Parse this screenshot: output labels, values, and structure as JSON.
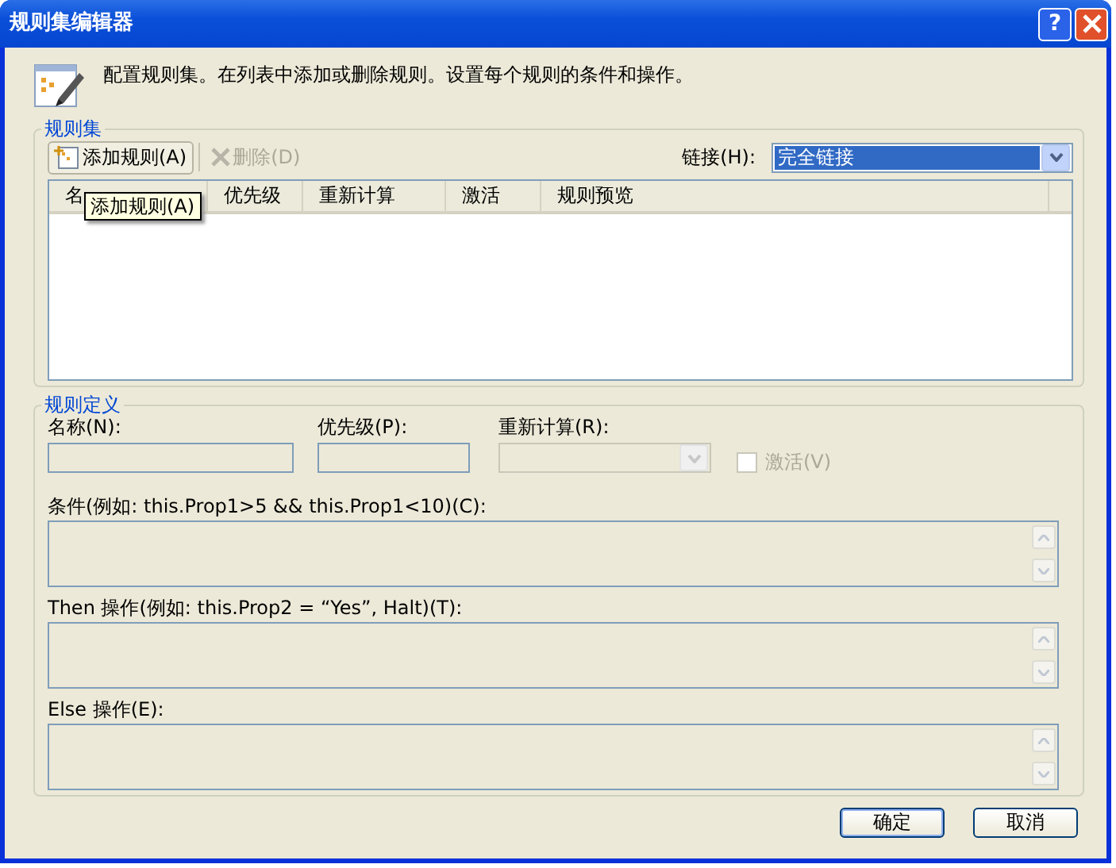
{
  "window": {
    "title": "规则集编辑器",
    "help": "?"
  },
  "description": "配置规则集。在列表中添加或删除规则。设置每个规则的条件和操作。",
  "rule_set": {
    "title": "规则集",
    "toolbar": [
      {
        "kind": "add",
        "label": "添加规则(A)",
        "disabled": false
      },
      {
        "kind": "delete",
        "label": "删除(D)",
        "disabled": true
      }
    ],
    "chaining": {
      "label": "链接(H):",
      "value": "完全链接",
      "focused": true
    },
    "columns": [
      "名",
      "优先级",
      "重新计算",
      "激活",
      "规则预览"
    ],
    "tooltip": "添加规则(A)"
  },
  "rule_definition": {
    "title": "规则定义",
    "name": {
      "label": "名称(N):"
    },
    "priority": {
      "label": "优先级(P):"
    },
    "reevaluation": {
      "label": "重新计算(R):",
      "disabled": true
    },
    "active": {
      "label": "激活(V)",
      "checked": false,
      "disabled": true
    },
    "editors": [
      {
        "label": "条件(例如: this.Prop1>5 && this.Prop1<10)(C):"
      },
      {
        "label": "Then 操作(例如: this.Prop2 = “Yes”, Halt)(T):"
      },
      {
        "label": "Else 操作(E):"
      }
    ]
  },
  "buttons": [
    {
      "label": "确定",
      "default": true
    },
    {
      "label": "取消",
      "default": false
    }
  ]
}
